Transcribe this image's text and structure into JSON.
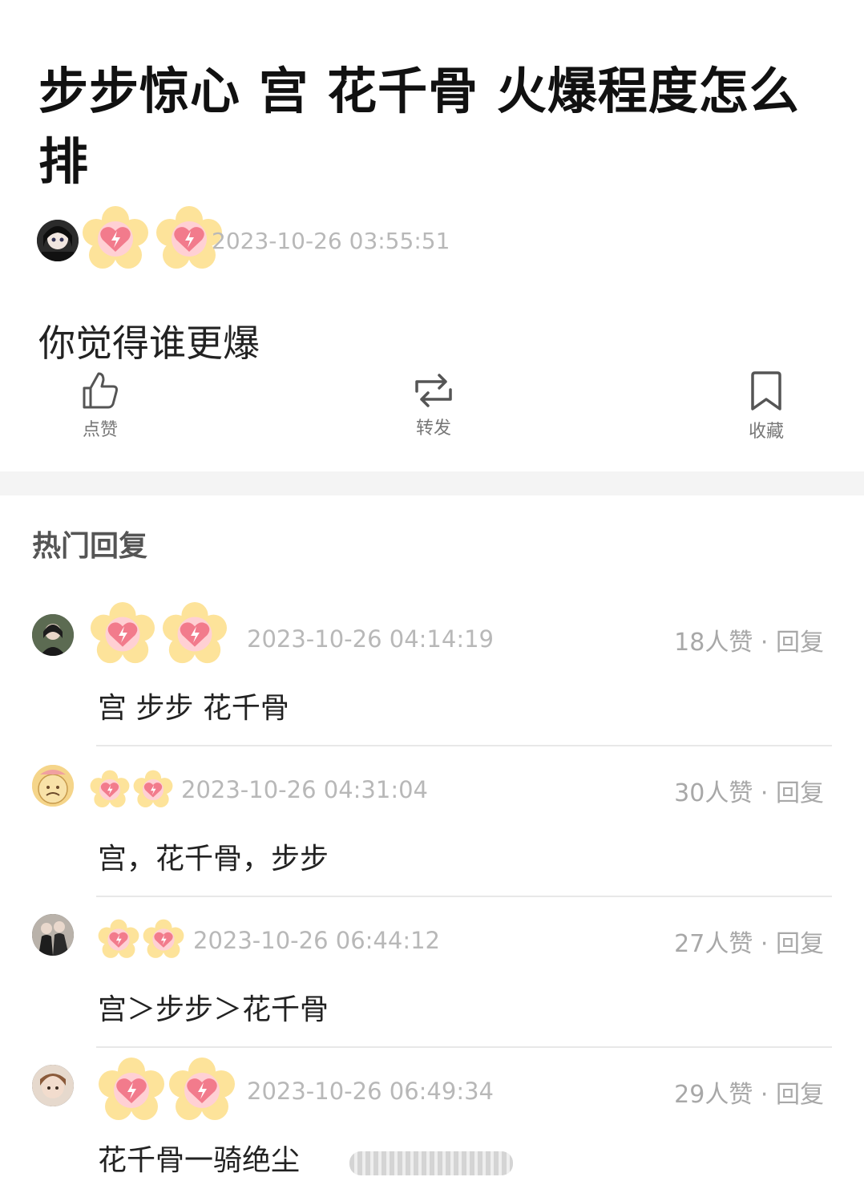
{
  "post": {
    "title": "步步惊心 宫 花千骨 火爆程度怎么排",
    "timestamp": "2023-10-26 03:55:51",
    "body": "你觉得谁更爆"
  },
  "actions": {
    "like_label": "点赞",
    "repost_label": "转发",
    "favorite_label": "收藏"
  },
  "section": {
    "title": "热门回复"
  },
  "comments": [
    {
      "timestamp": "2023-10-26 04:14:19",
      "likes": "18人赞",
      "sep": "·",
      "reply": "回复",
      "text": "宫 步步 花千骨"
    },
    {
      "timestamp": "2023-10-26 04:31:04",
      "likes": "30人赞",
      "sep": "·",
      "reply": "回复",
      "text": "宫，花千骨，步步"
    },
    {
      "timestamp": "2023-10-26 06:44:12",
      "likes": "27人赞",
      "sep": "·",
      "reply": "回复",
      "text": "宫＞步步＞花千骨"
    },
    {
      "timestamp": "2023-10-26 06:49:34",
      "likes": "29人赞",
      "sep": "·",
      "reply": "回复",
      "text": "花千骨一骑绝尘"
    }
  ],
  "colors": {
    "sticker_flower": "#fde39a",
    "sticker_heart": "#f27b8c",
    "muted": "#b8b8b8"
  }
}
